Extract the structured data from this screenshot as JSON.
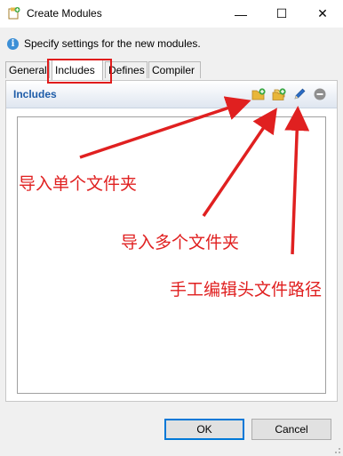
{
  "window": {
    "title": "Create Modules",
    "minimize_glyph": "—",
    "maximize_glyph": "☐",
    "close_glyph": "✕"
  },
  "info": {
    "icon_letter": "i",
    "text": "Specify settings for the new modules."
  },
  "tabs": [
    {
      "label": "General",
      "active": false
    },
    {
      "label": "Includes",
      "active": true
    },
    {
      "label": "Defines",
      "active": false
    },
    {
      "label": "Compiler",
      "active": false
    }
  ],
  "panel": {
    "title": "Includes",
    "tools": [
      "add-folder-icon",
      "add-folders-icon",
      "edit-pencil-icon",
      "remove-icon"
    ]
  },
  "annotations": {
    "single_folder": "导入单个文件夹",
    "multi_folder": "导入多个文件夹",
    "manual_path": "手工编辑头文件路径"
  },
  "buttons": {
    "ok": "OK",
    "cancel": "Cancel"
  },
  "colors": {
    "annotation": "#e02020",
    "title_blue": "#1e5ca8",
    "focus": "#0078d7"
  }
}
